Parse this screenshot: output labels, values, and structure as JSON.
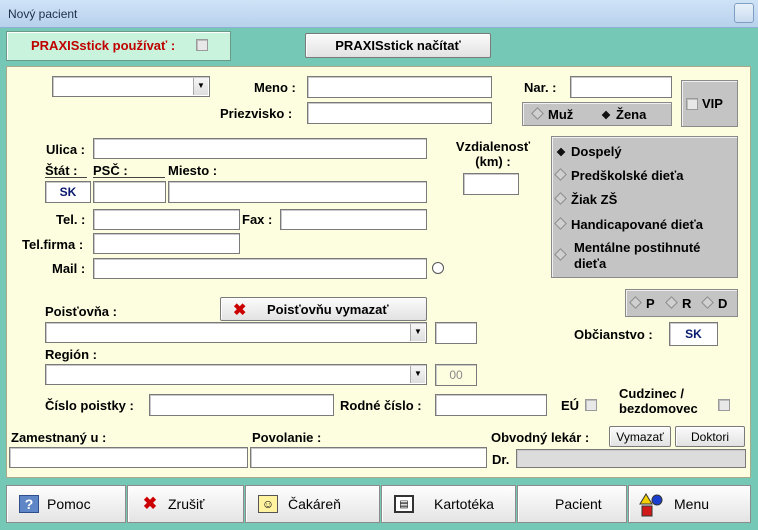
{
  "window": {
    "title": "Nový pacient"
  },
  "praxis": {
    "use_label": "PRAXISstick používať :",
    "load_button": "PRAXISstick načítať"
  },
  "form": {
    "meno_label": "Meno :",
    "priezvisko_label": "Priezvisko :",
    "nar_label": "Nar. :",
    "gender": {
      "male": "Muž",
      "female": "Žena",
      "selected": "female"
    },
    "vip_label": "VIP",
    "ulica_label": "Ulica :",
    "stat_label": "Štát :",
    "psc_label": "PSČ :",
    "miesto_label": "Miesto :",
    "stat_value": "SK",
    "vzdialenost_label": "Vzdialenosť (km) :",
    "tel_label": "Tel. :",
    "fax_label": "Fax :",
    "telfirma_label": "Tel.firma :",
    "mail_label": "Mail :",
    "category": {
      "options": [
        "Dospelý",
        "Predškolské dieťa",
        "Žiak ZŠ",
        "Handicapované dieťa",
        "Mentálne postihnuté dieťa"
      ],
      "selected": 0
    },
    "prd": [
      "P",
      "R",
      "D"
    ],
    "poistovna_label": "Poisťovňa :",
    "poistovna_clear_button": "Poisťovňu vymazať",
    "region_label": "Región :",
    "region_code": "00",
    "obcianstvo_label": "Občianstvo :",
    "obcianstvo_value": "SK",
    "cislo_poistky_label": "Číslo poistky :",
    "rodne_cislo_label": "Rodné číslo :",
    "eu_label": "EÚ",
    "cudzinec_label": "Cudzinec / bezdomovec",
    "zamestnany_label": "Zamestnaný u :",
    "povolanie_label": "Povolanie :",
    "obvodny_lekar_label": "Obvodný lekár :",
    "vymazat_button": "Vymazať",
    "doktori_button": "Doktori",
    "dr_label": "Dr."
  },
  "toolbar": {
    "pomoc": "Pomoc",
    "zrusit": "Zrušiť",
    "cakaren": "Čakáreň",
    "kartoteka": "Kartotéka",
    "pacient": "Pacient",
    "menu": "Menu"
  }
}
